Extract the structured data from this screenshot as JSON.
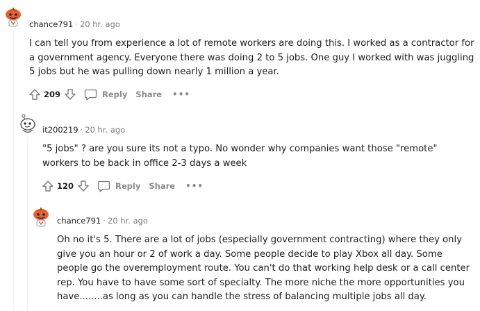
{
  "comments": [
    {
      "username": "chance791",
      "time": "20 hr. ago",
      "body": [
        "I can tell you from experience a lot of remote workers are doing this. I worked as a contractor for a government agency. Everyone there was doing 2 to 5 jobs. One guy I worked with was juggling 5 jobs but he was pulling down nearly 1 million a year."
      ],
      "score": "209",
      "reply_label": "Reply",
      "share_label": "Share",
      "more_label": "•••",
      "avatar_icon": "snoo-avatar-pumpkin-icon"
    },
    {
      "username": "it200219",
      "time": "20 hr. ago",
      "body": [
        "\"5 jobs\" ? are you sure its not a typo. No wonder why companies want those \"remote\" workers to be back in office 2-3 days a week"
      ],
      "score": "120",
      "reply_label": "Reply",
      "share_label": "Share",
      "more_label": "•••",
      "avatar_icon": "snoo-avatar-outline-icon"
    },
    {
      "username": "chance791",
      "time": "20 hr. ago",
      "body": [
        "Oh no it's 5. There are a lot of jobs (especially government contracting) where they only give you an hour or 2 of work a day. Some people decide to play Xbox all day. Some people go the overemployment route. You can't do that working help desk or a call center rep. You have to have some sort of specialty. The more niche the more opportunities you have........as long as you can handle the stress of balancing multiple jobs all day."
      ],
      "avatar_icon": "snoo-avatar-pumpkin-icon"
    }
  ],
  "colors": {
    "accent_orange": "#e8602c",
    "meta_gray": "#7c7c7c",
    "action_gray": "#878a8c"
  }
}
